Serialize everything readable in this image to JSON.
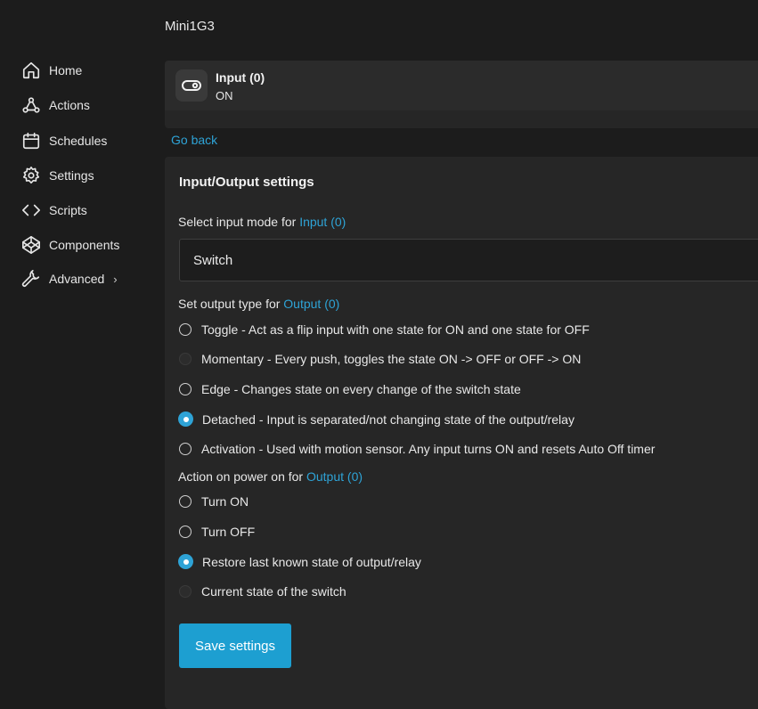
{
  "sidebar": {
    "items": [
      {
        "label": "Home",
        "icon": "home-icon"
      },
      {
        "label": "Actions",
        "icon": "webhook-icon"
      },
      {
        "label": "Schedules",
        "icon": "calendar-icon"
      },
      {
        "label": "Settings",
        "icon": "gear-icon"
      },
      {
        "label": "Scripts",
        "icon": "code-icon"
      },
      {
        "label": "Components",
        "icon": "codepen-icon"
      },
      {
        "label": "Advanced",
        "icon": "wrench-icon"
      }
    ],
    "advanced_chevron": "›"
  },
  "device": {
    "title": "Mini1G3"
  },
  "input_card": {
    "name": "Input (0)",
    "state": "ON",
    "icon": "toggle-icon"
  },
  "go_back": "Go back",
  "panel": {
    "title": "Input/Output settings",
    "input_mode": {
      "label": "Select input mode for ",
      "target": "Input (0)",
      "selected": "Switch"
    },
    "output_type": {
      "label": "Set output type for ",
      "target": "Output (0)",
      "options": [
        {
          "text": "Toggle - Act as a flip input with one state for ON and one state for OFF",
          "state": "unchecked"
        },
        {
          "text": "Momentary - Every push, toggles the state ON -> OFF or OFF -> ON",
          "state": "disabled"
        },
        {
          "text": "Edge - Changes state on every change of the switch state",
          "state": "unchecked"
        },
        {
          "text": "Detached - Input is separated/not changing state of the output/relay",
          "state": "checked"
        },
        {
          "text": "Activation - Used with motion sensor. Any input turns ON and resets Auto Off timer",
          "state": "unchecked"
        }
      ]
    },
    "power_on": {
      "label": "Action on power on for ",
      "target": "Output (0)",
      "options": [
        {
          "text": "Turn ON",
          "state": "unchecked"
        },
        {
          "text": "Turn OFF",
          "state": "unchecked"
        },
        {
          "text": "Restore last known state of output/relay",
          "state": "checked"
        },
        {
          "text": "Current state of the switch",
          "state": "disabled"
        }
      ]
    },
    "save_label": "Save settings"
  },
  "colors": {
    "accent": "#2ea3d6",
    "button": "#1d9fd1",
    "background": "#1c1c1c",
    "panel": "#262626"
  }
}
